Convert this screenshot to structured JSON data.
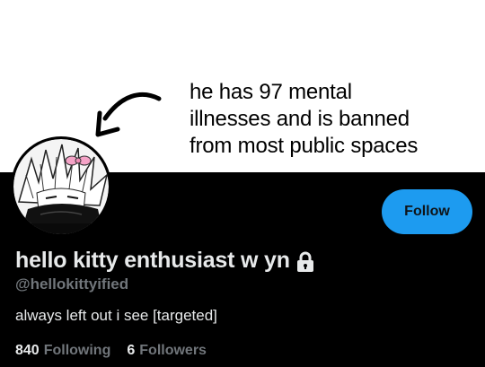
{
  "banner": {
    "lines": [
      "he has 97 mental",
      "illnesses and is banned",
      "from most public spaces"
    ]
  },
  "profile": {
    "display_name": "hello kitty enthusiast w yn",
    "handle": "@hellokittyified",
    "bio": "always left out i see [targeted]",
    "follow_label": "Follow"
  },
  "stats": {
    "following_count": "840",
    "following_label": "Following",
    "followers_count": "6",
    "followers_label": "Followers"
  },
  "colors": {
    "background": "#000000",
    "accent": "#1d9bf0",
    "primary_text": "#e7e9ea",
    "secondary_text": "#71767b",
    "bow": "#f5a3c7"
  },
  "icons": {
    "lock": "lock-icon",
    "arrow": "arrow-icon"
  }
}
